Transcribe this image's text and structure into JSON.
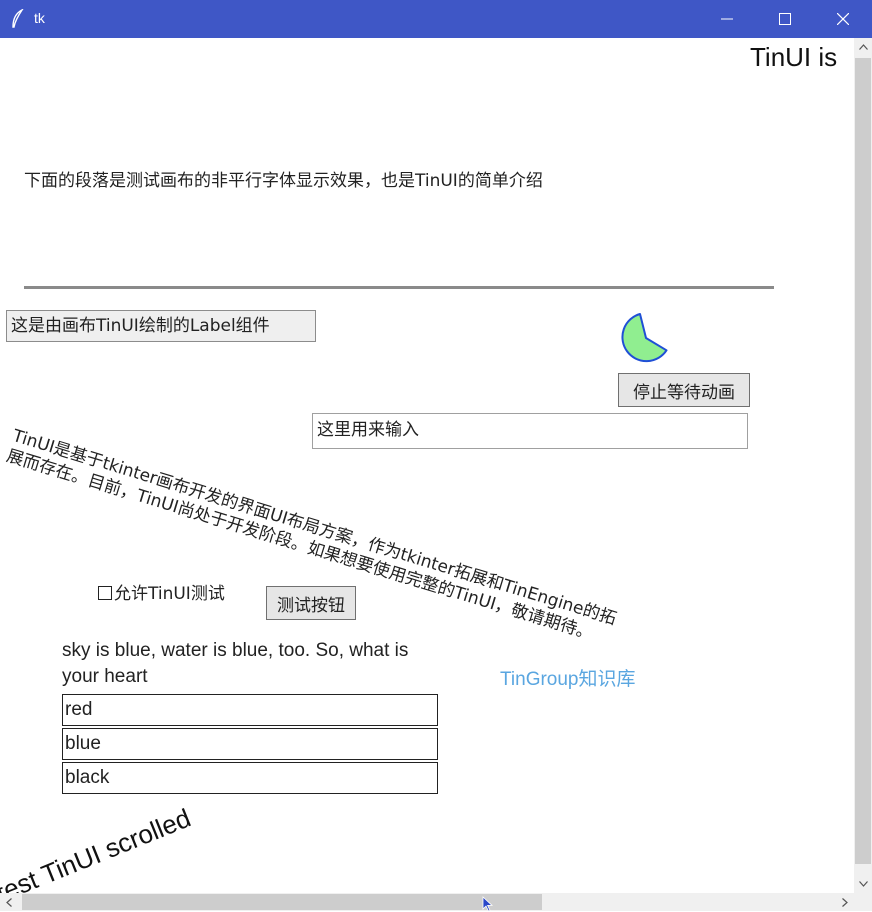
{
  "window": {
    "title": "tk",
    "icons": [
      "feather-icon",
      "minimize-icon",
      "maximize-icon",
      "close-icon"
    ]
  },
  "canvas": {
    "header_text": "TinUI is",
    "paragraph_title": "下面的段落是测试画布的非平行字体显示效果，也是TinUI的简单介绍",
    "label": "这是由画布TinUI绘制的Label组件",
    "stop_button": "停止等待动画",
    "entry_value": "这里用来输入",
    "rotated_paragraph": "TinUI是基于tkinter画布开发的界面UI布局方案，作为tkinter拓展和TinEngine的拓展而存在。目前，TinUI尚处于开发阶段。如果想要使用完整的TinUI，敬请期待。",
    "checkbox_label": "允许TinUI测试",
    "test_button": "测试按钮",
    "question": "sky is blue, water is blue, too. So, what is your heart",
    "options": [
      "red",
      "blue",
      "black"
    ],
    "link": "TinGroup知识库",
    "scrolled_text": "test TinUI scrolled"
  },
  "colors": {
    "titlebar": "#3f57c6",
    "pie_fill": "#90ee90",
    "pie_stroke": "#1f4fd6",
    "link": "#5aa6e0"
  }
}
